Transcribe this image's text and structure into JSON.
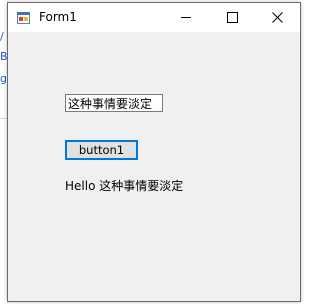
{
  "window": {
    "title": "Form1",
    "icon": "winforms-app-icon",
    "controls": {
      "minimize": "minimize-icon",
      "maximize": "maximize-icon",
      "close": "close-icon"
    }
  },
  "background_fragments": {
    "line1": "/",
    "line2": "Ba",
    "line3": "g_"
  },
  "form": {
    "textbox_value": "这种事情要淡定",
    "button_label": "button1",
    "label_text": "Hello 这种事情要淡定"
  },
  "colors": {
    "client_bg": "#f0f0f0",
    "button_focus_border": "#0078d7",
    "button_bg": "#e1e1e1",
    "link_blue": "#2a57c7"
  }
}
